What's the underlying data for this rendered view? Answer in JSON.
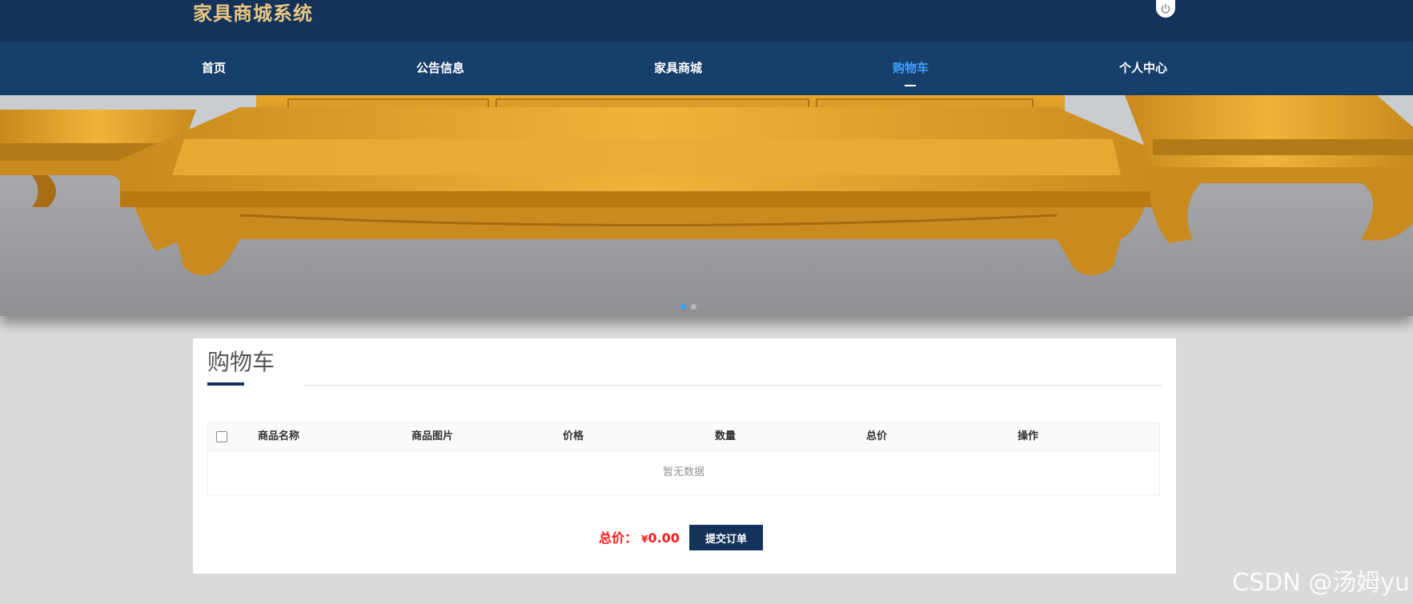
{
  "header": {
    "site_title": "家具商城系统",
    "power_icon": "power-icon"
  },
  "nav": {
    "items": [
      {
        "label": "首页"
      },
      {
        "label": "公告信息"
      },
      {
        "label": "家具商城"
      },
      {
        "label": "购物车",
        "active": true
      },
      {
        "label": "个人中心"
      }
    ],
    "active_color": "#409eff",
    "bar_color": "#173f6b"
  },
  "banner": {
    "slide_count": 2,
    "active_slide": 1
  },
  "cart": {
    "title": "购物车",
    "columns": [
      "商品名称",
      "商品图片",
      "价格",
      "数量",
      "总价",
      "操作"
    ],
    "empty_text": "暂无数据",
    "total_label": "总价：",
    "currency": "¥",
    "total_amount": "0.00",
    "submit_label": "提交订单"
  },
  "watermark": "CSDN @汤姆yu",
  "colors": {
    "primary": "#13335a",
    "title_gold": "#e8c783",
    "price_red": "#ff1a1a"
  }
}
